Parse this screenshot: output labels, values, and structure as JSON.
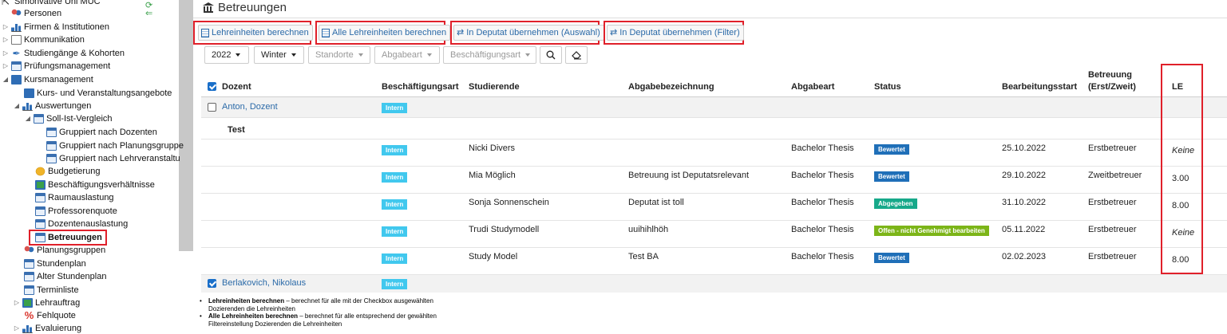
{
  "sidebar": {
    "items": [
      {
        "label": "Simonvative Uni MUC",
        "icon": "cursor-icon",
        "level": 0
      },
      {
        "label": "Personen",
        "icon": "people-icon",
        "level": 0
      },
      {
        "label": "Firmen & Institutionen",
        "icon": "factory-icon",
        "level": 0
      },
      {
        "label": "Kommunikation",
        "icon": "envelope-icon",
        "level": 0
      },
      {
        "label": "Studiengänge & Kohorten",
        "icon": "pen-icon",
        "level": 0
      },
      {
        "label": "Prüfungsmanagement",
        "icon": "calendar-icon",
        "level": 0
      },
      {
        "label": "Kursmanagement",
        "icon": "book-icon",
        "level": 0
      },
      {
        "label": "Kurs- und Veranstaltungsangebote",
        "icon": "book-icon",
        "level": 1
      },
      {
        "label": "Auswertungen",
        "icon": "bar-chart-icon",
        "level": 1
      },
      {
        "label": "Soll-Ist-Vergleich",
        "icon": "calendar-icon",
        "level": 2
      },
      {
        "label": "Gruppiert nach Dozenten",
        "icon": "calendar-icon",
        "level": 3
      },
      {
        "label": "Gruppiert nach Planungsgruppe",
        "icon": "calendar-icon",
        "level": 3
      },
      {
        "label": "Gruppiert nach Lehrveranstaltu",
        "icon": "calendar-icon",
        "level": 3
      },
      {
        "label": "Budgetierung",
        "icon": "coins-icon",
        "level": 2
      },
      {
        "label": "Beschäftigungsverhältnisse",
        "icon": "gear-icon",
        "level": 2
      },
      {
        "label": "Raumauslastung",
        "icon": "calendar-icon",
        "level": 2
      },
      {
        "label": "Professorenquote",
        "icon": "calendar-icon",
        "level": 2
      },
      {
        "label": "Dozentenauslastung",
        "icon": "calendar-icon",
        "level": 2
      },
      {
        "label": "Betreuungen",
        "icon": "calendar-icon",
        "level": 2
      },
      {
        "label": "Planungsgruppen",
        "icon": "people-icon",
        "level": 1
      },
      {
        "label": "Stundenplan",
        "icon": "calendar-icon",
        "level": 1
      },
      {
        "label": "Alter Stundenplan",
        "icon": "calendar-icon",
        "level": 1
      },
      {
        "label": "Terminliste",
        "icon": "calendar-icon",
        "level": 1
      },
      {
        "label": "Lehrauftrag",
        "icon": "gear-icon",
        "level": 1
      },
      {
        "label": "Fehlquote",
        "icon": "percent-icon",
        "level": 1
      },
      {
        "label": "Evaluierung",
        "icon": "bar-chart-icon",
        "level": 1
      }
    ]
  },
  "page": {
    "title": "Betreuungen"
  },
  "actions": {
    "calc": "Lehreinheiten berechnen",
    "calc_all": "Alle Lehreinheiten berechnen",
    "deputat_selection": "In Deputat übernehmen (Auswahl)",
    "deputat_filter": "In Deputat übernehmen (Filter)"
  },
  "filters": {
    "year": "2022",
    "term": "Winter",
    "location": "Standorte",
    "submission_type": "Abgabeart",
    "employment_type": "Beschäftigungsart"
  },
  "table": {
    "headers": {
      "lecturer": "Dozent",
      "employment": "Beschäftigungsart",
      "students": "Studierende",
      "submission_title": "Abgabebezeichnung",
      "submission_type": "Abgabeart",
      "status": "Status",
      "start": "Bearbeitungsstart",
      "supervision_1": "Betreuung",
      "supervision_2": "(Erst/Zweit)",
      "le": "LE"
    },
    "groups": [
      {
        "name": "Anton, Dozent",
        "employment": "Intern"
      },
      {
        "name": "Berlakovich, Nikolaus",
        "employment": "Intern"
      }
    ],
    "subgroup": "Test",
    "rows": [
      {
        "employment": "Intern",
        "student": "Nicki Divers",
        "title": "",
        "type": "Bachelor Thesis",
        "status": "Bewertet",
        "start": "25.10.2022",
        "supervision": "Erstbetreuer",
        "le": "Keine"
      },
      {
        "employment": "Intern",
        "student": "Mia Möglich",
        "title": "Betreuung ist Deputatsrelevant",
        "type": "Bachelor Thesis",
        "status": "Bewertet",
        "start": "29.10.2022",
        "supervision": "Zweitbetreuer",
        "le": "3.00"
      },
      {
        "employment": "Intern",
        "student": "Sonja Sonnenschein",
        "title": "Deputat ist toll",
        "type": "Bachelor Thesis",
        "status": "Abgegeben",
        "start": "31.10.2022",
        "supervision": "Erstbetreuer",
        "le": "8.00"
      },
      {
        "employment": "Intern",
        "student": "Trudi Studymodell",
        "title": "uuihihlhöh",
        "type": "Bachelor Thesis",
        "status": "Offen - nicht Genehmigt bearbeiten",
        "start": "05.11.2022",
        "supervision": "Erstbetreuer",
        "le": "Keine"
      },
      {
        "employment": "Intern",
        "student": "Study Model",
        "title": "Test BA",
        "type": "Bachelor Thesis",
        "status": "Bewertet",
        "start": "02.02.2023",
        "supervision": "Erstbetreuer",
        "le": "8.00"
      }
    ]
  },
  "status_colors": {
    "Bewertet": "#1f6fb8",
    "Abgegeben": "#17a98a",
    "Offen - nicht Genehmigt bearbeiten": "#7cb518",
    "Intern": "#41c8ee"
  },
  "notes": [
    {
      "bold": "Lehreinheiten berechnen",
      "text": " – berechnet für alle mit der Checkbox ausgewählten",
      "cont": "Dozierenden die Lehreinheiten"
    },
    {
      "bold": "Alle Lehreinheiten berechnen",
      "text": " – berechnet für alle entsprechend der gewählten",
      "cont": "Filtereinstellung Dozierenden die Lehreinheiten"
    }
  ]
}
